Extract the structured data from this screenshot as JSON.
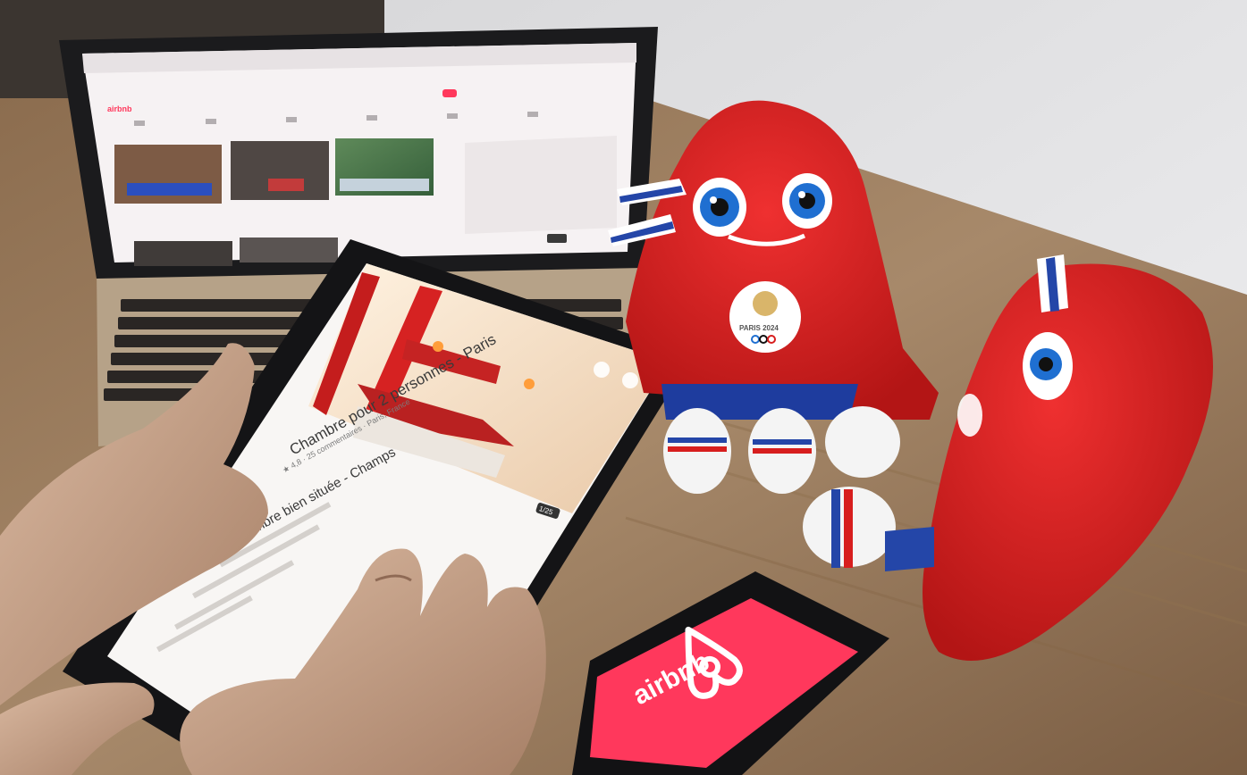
{
  "scene": {
    "colors": {
      "wall": "#e9e9eb",
      "table": "#a58664",
      "laptop_body": "#b9a58c",
      "laptop_bezel": "#1d1d1f",
      "browser_bg": "#f7f3f4",
      "airbnb_red": "#ff385c",
      "tablet_body": "#18181a",
      "mascot_red": "#d71e1e",
      "skin": "#c8a58b"
    }
  },
  "laptop": {
    "airbnb_brand_text": "airbnb"
  },
  "tablet": {
    "photo_counter": "1/25",
    "listing_title": "Chambre pour 2 personnes - Paris",
    "listing_subtitle": "Chambre bien située - Champs",
    "rating_line": "★ 4,8 · 25 commentaires · Paris, France"
  },
  "phone": {
    "app_label": "airbnb",
    "icon_name": "airbnb-belo-logo-icon"
  },
  "mascot": {
    "badge": "PARIS 2024"
  }
}
